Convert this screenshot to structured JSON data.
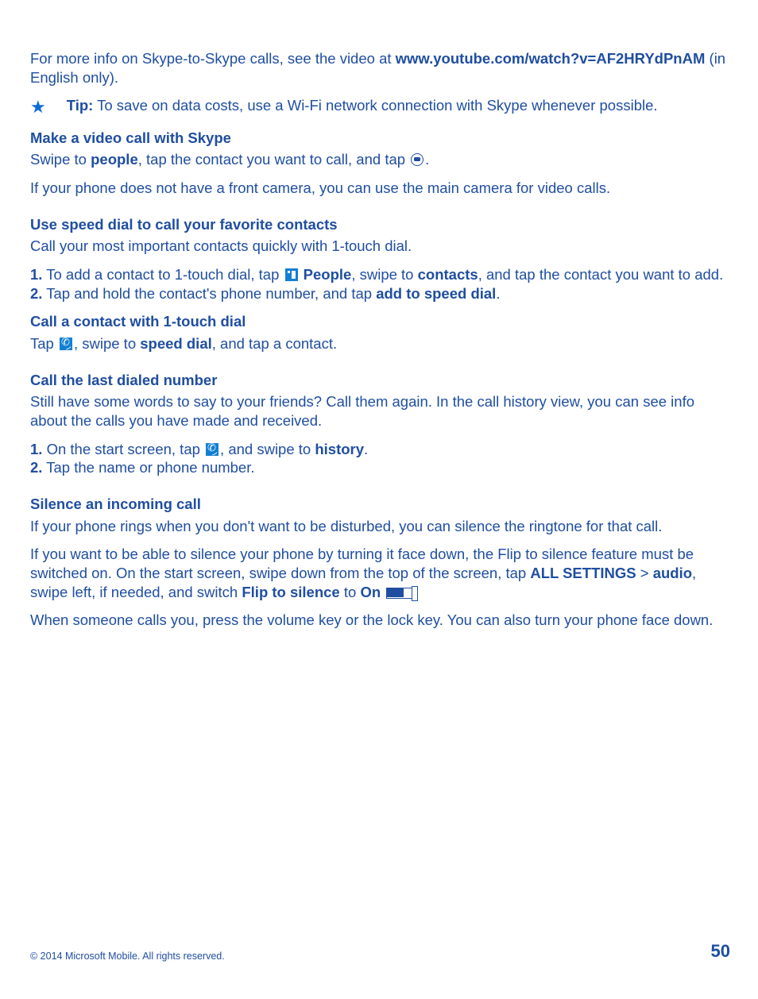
{
  "intro": {
    "pre": "For more info on Skype-to-Skype calls, see the video at ",
    "link": "www.youtube.com/watch?v=AF2HRYdPnAM",
    "post": " (in English only)."
  },
  "tip": {
    "label": "Tip:",
    "text": " To save on data costs, use a Wi-Fi network connection with Skype whenever possible."
  },
  "sec1": {
    "heading": "Make a video call with Skype",
    "p1a": "Swipe to ",
    "people": "people",
    "p1b": ", tap the contact you want to call, and tap ",
    "p1c": ".",
    "p2": "If your phone does not have a front camera, you can use the main camera for video calls."
  },
  "sec2": {
    "heading": "Use speed dial to call your favorite contacts",
    "intro": "Call your most important contacts quickly with 1-touch dial.",
    "n1": "1.",
    "s1a": " To add a contact to 1-touch dial, tap ",
    "people_label": " People",
    "s1b": ", swipe to ",
    "contacts": "contacts",
    "s1c": ", and tap the contact you want to add.",
    "n2": "2.",
    "s2a": " Tap and hold the contact's phone number, and tap ",
    "addspeed": "add to speed dial",
    "s2b": ".",
    "sub_heading": "Call a contact with 1-touch dial",
    "sub_a": "Tap ",
    "sub_b": ", swipe to ",
    "speeddial": "speed dial",
    "sub_c": ", and tap a contact."
  },
  "sec3": {
    "heading": "Call the last dialed number",
    "intro": "Still have some words to say to your friends? Call them again. In the call history view, you can see info about the calls you have made and received.",
    "n1": "1.",
    "s1a": " On the start screen, tap ",
    "s1b": ", and swipe to ",
    "history": "history",
    "s1c": ".",
    "n2": "2.",
    "s2": " Tap the name or phone number."
  },
  "sec4": {
    "heading": "Silence an incoming call",
    "p1": "If your phone rings when you don't want to be disturbed, you can silence the ringtone for that call.",
    "p2a": "If you want to be able to silence your phone by turning it face down, the Flip to silence feature must be switched on. On the start screen, swipe down from the top of the screen, tap ",
    "allsettings": "ALL SETTINGS",
    "gt": " > ",
    "audio": "audio",
    "p2b": ", swipe left, if needed, and switch ",
    "flip": "Flip to silence",
    "to": " to ",
    "on": "On",
    "p2c": ".",
    "p3": "When someone calls you, press the volume key or the lock key. You can also turn your phone face down."
  },
  "footer": {
    "copyright": "© 2014 Microsoft Mobile. All rights reserved.",
    "page": "50"
  }
}
